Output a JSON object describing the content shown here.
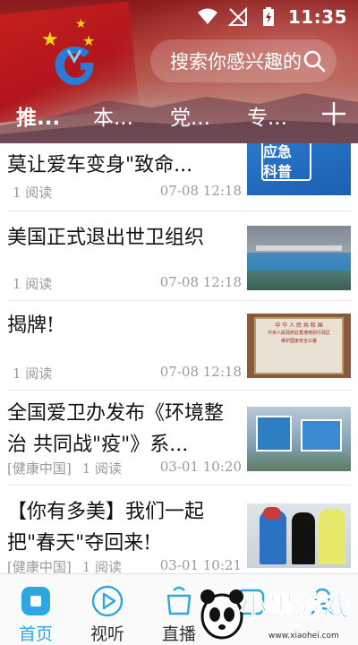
{
  "status_bar": {
    "time": "11:35"
  },
  "header": {
    "search_placeholder": "搜索你感兴趣的",
    "tabs": [
      {
        "label": "推..."
      },
      {
        "label": "本..."
      },
      {
        "label": "党..."
      },
      {
        "label": "专..."
      }
    ],
    "add_tab_icon": "plus-icon"
  },
  "news": [
    {
      "title": "应急科普丨注意!夏季高温,莫让爱车变身\"致命...",
      "source": "",
      "reads": "1 阅读",
      "time": "07-08 12:18",
      "thumb_text": [
        "应急",
        "科普"
      ]
    },
    {
      "title": "美国正式退出世卫组织",
      "source": "",
      "reads": "1 阅读",
      "time": "07-08 12:18"
    },
    {
      "title": "揭牌!",
      "source": "",
      "reads": "1 阅读",
      "time": "07-08 12:18",
      "thumb_text": [
        "中 华 人 民 共 和 国",
        "中央人民政府驻香港特别行政区",
        "维护国家安全公署"
      ]
    },
    {
      "title": "全国爱卫办发布《环境整治 共同战\"疫\"》系...",
      "source": "[健康中国]",
      "reads": "1 阅读",
      "time": "03-01 10:20"
    },
    {
      "title": "【你有多美】我们一起把\"春天\"夺回来!",
      "source": "[健康中国]",
      "reads": "1 阅读",
      "time": "03-01 10:21"
    }
  ],
  "bottom_nav": [
    {
      "label": "首页",
      "icon": "home-icon",
      "active": true
    },
    {
      "label": "视听",
      "icon": "play-icon",
      "active": false
    },
    {
      "label": "直播",
      "icon": "live-icon",
      "active": false
    },
    {
      "label": "",
      "icon": "service-icon",
      "active": false
    },
    {
      "label": "",
      "icon": "user-icon",
      "active": false
    }
  ],
  "watermark": {
    "text": "小黑游戏",
    "url": "www.xiaohei.com"
  },
  "colors": {
    "accent": "#2ea7e0",
    "header_red": "#a9302c"
  }
}
